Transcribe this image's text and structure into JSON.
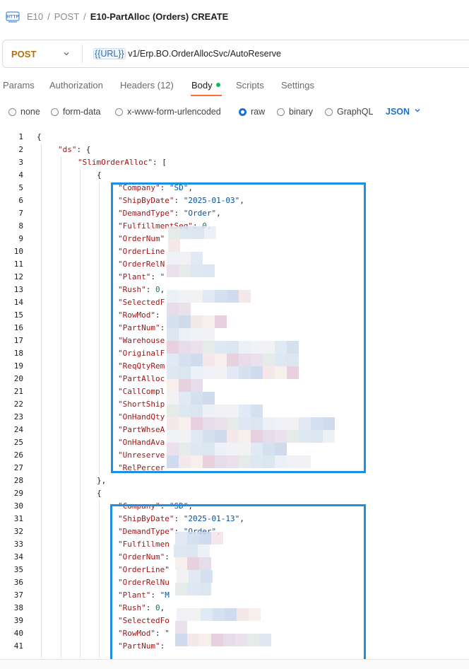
{
  "breadcrumb": {
    "items": [
      "E10",
      "POST"
    ],
    "current": "E10-PartAlloc (Orders) CREATE",
    "separator": "/"
  },
  "request": {
    "method": "POST",
    "url_variable": "{{URL}}",
    "url_path": "v1/Erp.BO.OrderAllocSvc/AutoReserve"
  },
  "tabs": [
    {
      "label": "Params"
    },
    {
      "label": "Authorization"
    },
    {
      "label": "Headers (12)"
    },
    {
      "label": "Body",
      "active": true
    },
    {
      "label": "Scripts"
    },
    {
      "label": "Settings"
    }
  ],
  "body_types": {
    "options": [
      "none",
      "form-data",
      "x-www-form-urlencoded",
      "raw",
      "binary",
      "GraphQL"
    ],
    "selected": "raw",
    "format": "JSON"
  },
  "editor": {
    "lines": [
      {
        "n": "1",
        "indent": 0,
        "parts": [
          [
            "p",
            "{"
          ]
        ]
      },
      {
        "n": "2",
        "indent": 1,
        "parts": [
          [
            "k",
            "\"ds\""
          ],
          [
            "p",
            ": {"
          ]
        ]
      },
      {
        "n": "3",
        "indent": 2,
        "parts": [
          [
            "k",
            "\"SlimOrderAlloc\""
          ],
          [
            "p",
            ": ["
          ]
        ]
      },
      {
        "n": "4",
        "indent": 3,
        "parts": [
          [
            "p",
            "{"
          ]
        ]
      },
      {
        "n": "5",
        "indent": 4,
        "parts": [
          [
            "k",
            "\"Company\""
          ],
          [
            "p",
            ": "
          ],
          [
            "s",
            "\"SD\""
          ],
          [
            "p",
            ","
          ]
        ]
      },
      {
        "n": "6",
        "indent": 4,
        "parts": [
          [
            "k",
            "\"ShipByDate\""
          ],
          [
            "p",
            ": "
          ],
          [
            "s",
            "\"2025-01-03\""
          ],
          [
            "p",
            ","
          ]
        ]
      },
      {
        "n": "7",
        "indent": 4,
        "parts": [
          [
            "k",
            "\"DemandType\""
          ],
          [
            "p",
            ": "
          ],
          [
            "s",
            "\"Order\""
          ],
          [
            "p",
            ","
          ]
        ]
      },
      {
        "n": "8",
        "indent": 4,
        "parts": [
          [
            "k",
            "\"FulfillmentSeq\""
          ],
          [
            "p",
            ": "
          ],
          [
            "n",
            "0"
          ],
          [
            "p",
            ","
          ]
        ]
      },
      {
        "n": "9",
        "indent": 4,
        "parts": [
          [
            "k",
            "\"OrderNum\""
          ]
        ]
      },
      {
        "n": "10",
        "indent": 4,
        "parts": [
          [
            "k",
            "\"OrderLine"
          ]
        ]
      },
      {
        "n": "11",
        "indent": 4,
        "parts": [
          [
            "k",
            "\"OrderRelN"
          ]
        ]
      },
      {
        "n": "12",
        "indent": 4,
        "parts": [
          [
            "k",
            "\"Plant\""
          ],
          [
            "p",
            ": "
          ],
          [
            "s",
            "\""
          ]
        ]
      },
      {
        "n": "13",
        "indent": 4,
        "parts": [
          [
            "k",
            "\"Rush\""
          ],
          [
            "p",
            ": "
          ],
          [
            "n",
            "0"
          ],
          [
            "p",
            ","
          ]
        ]
      },
      {
        "n": "14",
        "indent": 4,
        "parts": [
          [
            "k",
            "\"SelectedF"
          ]
        ]
      },
      {
        "n": "15",
        "indent": 4,
        "parts": [
          [
            "k",
            "\"RowMod\""
          ],
          [
            "p",
            ":"
          ]
        ]
      },
      {
        "n": "16",
        "indent": 4,
        "parts": [
          [
            "k",
            "\"PartNum\""
          ],
          [
            "p",
            ":"
          ]
        ]
      },
      {
        "n": "17",
        "indent": 4,
        "parts": [
          [
            "k",
            "\"Warehouse"
          ]
        ]
      },
      {
        "n": "18",
        "indent": 4,
        "parts": [
          [
            "k",
            "\"OriginalF"
          ]
        ]
      },
      {
        "n": "19",
        "indent": 4,
        "parts": [
          [
            "k",
            "\"ReqQtyRem"
          ]
        ]
      },
      {
        "n": "20",
        "indent": 4,
        "parts": [
          [
            "k",
            "\"PartAlloc"
          ]
        ]
      },
      {
        "n": "21",
        "indent": 4,
        "parts": [
          [
            "k",
            "\"CallCompl"
          ]
        ]
      },
      {
        "n": "22",
        "indent": 4,
        "parts": [
          [
            "k",
            "\"ShortShip"
          ]
        ]
      },
      {
        "n": "23",
        "indent": 4,
        "parts": [
          [
            "k",
            "\"OnHandQty"
          ]
        ]
      },
      {
        "n": "24",
        "indent": 4,
        "parts": [
          [
            "k",
            "\"PartWhseA"
          ]
        ]
      },
      {
        "n": "25",
        "indent": 4,
        "parts": [
          [
            "k",
            "\"OnHandAva"
          ]
        ]
      },
      {
        "n": "26",
        "indent": 4,
        "parts": [
          [
            "k",
            "\"Unreserve"
          ]
        ]
      },
      {
        "n": "27",
        "indent": 4,
        "parts": [
          [
            "k",
            "\"RelPercer"
          ]
        ]
      },
      {
        "n": "28",
        "indent": 3,
        "parts": [
          [
            "p",
            "},"
          ]
        ]
      },
      {
        "n": "29",
        "indent": 3,
        "parts": [
          [
            "p",
            "{"
          ]
        ]
      },
      {
        "n": "30",
        "indent": 4,
        "parts": [
          [
            "k",
            "\"Company\""
          ],
          [
            "p",
            ": "
          ],
          [
            "s",
            "\"SD\""
          ],
          [
            "p",
            ","
          ]
        ]
      },
      {
        "n": "31",
        "indent": 4,
        "parts": [
          [
            "k",
            "\"ShipByDate\""
          ],
          [
            "p",
            ": "
          ],
          [
            "s",
            "\"2025-01-13\""
          ],
          [
            "p",
            ","
          ]
        ]
      },
      {
        "n": "32",
        "indent": 4,
        "parts": [
          [
            "k",
            "\"DemandType\""
          ],
          [
            "p",
            ": "
          ],
          [
            "s",
            "\"Order\""
          ],
          [
            "p",
            ","
          ]
        ]
      },
      {
        "n": "33",
        "indent": 4,
        "parts": [
          [
            "k",
            "\"Fulfillmen"
          ]
        ]
      },
      {
        "n": "34",
        "indent": 4,
        "parts": [
          [
            "k",
            "\"OrderNum\""
          ],
          [
            "p",
            ":"
          ]
        ]
      },
      {
        "n": "35",
        "indent": 4,
        "parts": [
          [
            "k",
            "\"OrderLine\""
          ]
        ]
      },
      {
        "n": "36",
        "indent": 4,
        "parts": [
          [
            "k",
            "\"OrderRelNu"
          ]
        ]
      },
      {
        "n": "37",
        "indent": 4,
        "parts": [
          [
            "k",
            "\"Plant\""
          ],
          [
            "p",
            ": "
          ],
          [
            "s",
            "\"M"
          ]
        ]
      },
      {
        "n": "38",
        "indent": 4,
        "parts": [
          [
            "k",
            "\"Rush\""
          ],
          [
            "p",
            ": "
          ],
          [
            "n",
            "0"
          ],
          [
            "p",
            ","
          ]
        ]
      },
      {
        "n": "39",
        "indent": 4,
        "parts": [
          [
            "k",
            "\"SelectedFo"
          ]
        ]
      },
      {
        "n": "40",
        "indent": 4,
        "parts": [
          [
            "k",
            "\"RowMod\""
          ],
          [
            "p",
            ": "
          ],
          [
            "s",
            "\""
          ]
        ]
      },
      {
        "n": "41",
        "indent": 4,
        "parts": [
          [
            "k",
            "\"PartNum\""
          ],
          [
            "p",
            ":"
          ]
        ]
      }
    ]
  },
  "colors": {
    "accent": "#ff6c37",
    "method": "#b5700a",
    "highlight_box": "#1b8fe0",
    "json_key": "#a31515",
    "json_string": "#0451a5",
    "json_number": "#098658"
  }
}
